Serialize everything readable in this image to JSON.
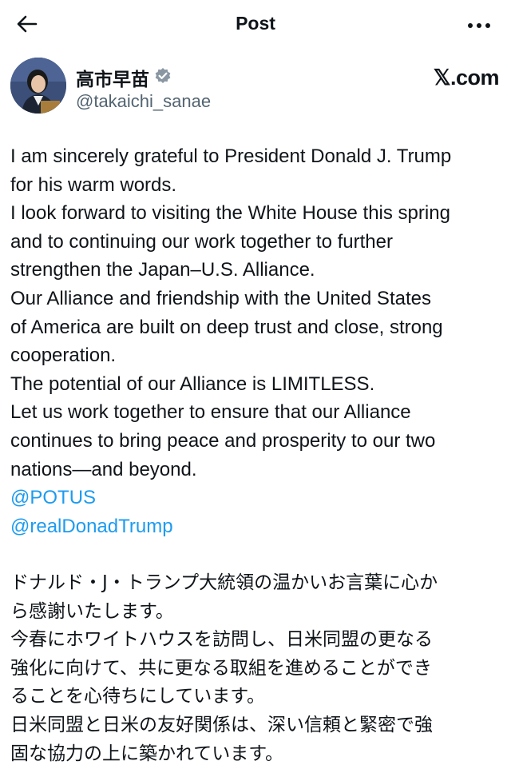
{
  "header": {
    "title": "Post"
  },
  "author": {
    "display_name": "高市早苗",
    "handle": "@takaichi_sanae",
    "verified": true,
    "avatar_icon": "profile-photo"
  },
  "watermark": "𝕏.com",
  "colors": {
    "link": "#1d9bf0",
    "text": "#0f1419",
    "secondary": "#536471"
  },
  "tweet": {
    "en_lines": [
      "I am sincerely grateful to President Donald J. Trump",
      "for his warm words.",
      "I look forward to visiting the White House this spring",
      "and to continuing our work together to further",
      "strengthen the Japan–U.S. Alliance.",
      "Our Alliance and friendship with the United States",
      "of America are built on deep trust and close, strong",
      "cooperation.",
      "The potential of our Alliance is LIMITLESS.",
      "Let us work together to ensure that our Alliance",
      "continues to bring peace and prosperity to our two",
      "nations—and beyond."
    ],
    "mentions": [
      "@POTUS",
      "@realDonadTrump"
    ],
    "jp_lines": [
      "ドナルド・J・トランプ大統領の温かいお言葉に心か",
      "ら感謝いたします。",
      "今春にホワイトハウスを訪問し、日米同盟の更なる",
      "強化に向けて、共に更なる取組を進めることができ",
      "ることを心待ちにしています。",
      "日米同盟と日米の友好関係は、深い信頼と緊密で強",
      "固な協力の上に築かれています。"
    ]
  }
}
